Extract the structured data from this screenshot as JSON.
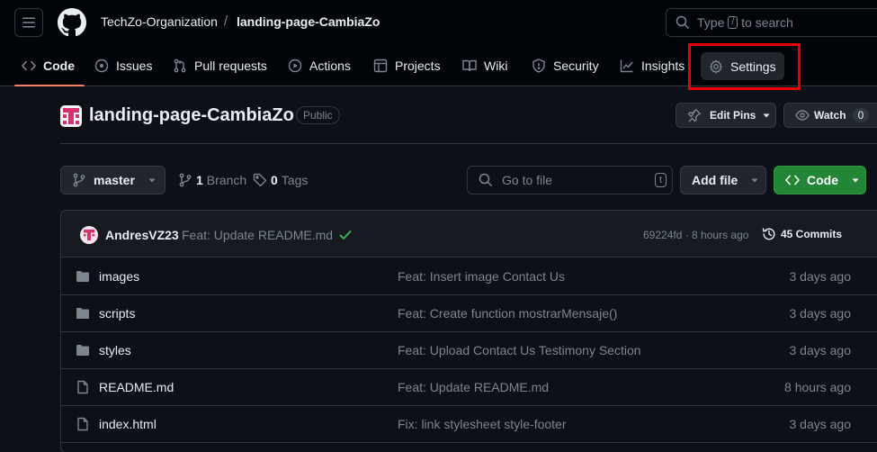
{
  "header": {
    "owner": "TechZo-Organization",
    "separator": "/",
    "repo": "landing-page-CambiaZo",
    "search_prefix": "Type",
    "search_key": "/",
    "search_suffix": "to search"
  },
  "nav": {
    "items": [
      {
        "label": "Code",
        "icon": "code-icon",
        "active": true
      },
      {
        "label": "Issues",
        "icon": "issue-icon"
      },
      {
        "label": "Pull requests",
        "icon": "pull-request-icon"
      },
      {
        "label": "Actions",
        "icon": "play-icon"
      },
      {
        "label": "Projects",
        "icon": "table-icon"
      },
      {
        "label": "Wiki",
        "icon": "book-icon"
      },
      {
        "label": "Security",
        "icon": "shield-icon"
      },
      {
        "label": "Insights",
        "icon": "graph-icon"
      },
      {
        "label": "Settings",
        "icon": "gear-icon"
      }
    ]
  },
  "repo_header": {
    "title": "landing-page-CambiaZo",
    "visibility": "Public",
    "edit_pins": "Edit Pins",
    "watch": "Watch",
    "watch_count": "0"
  },
  "toolbar": {
    "branch": "master",
    "branch_count": "1",
    "branch_label": "Branch",
    "tag_count": "0",
    "tag_label": "Tags",
    "goto_placeholder": "Go to file",
    "goto_key": "t",
    "add_file": "Add file",
    "code": "Code"
  },
  "commit": {
    "user": "AndresVZ23",
    "message": "Feat: Update README.md",
    "sha_time": "69224fd · 8 hours ago",
    "commits": "45 Commits"
  },
  "files": [
    {
      "name": "images",
      "type": "folder",
      "message": "Feat: Insert image Contact Us",
      "date": "3 days ago"
    },
    {
      "name": "scripts",
      "type": "folder",
      "message": "Feat: Create function mostrarMensaje()",
      "date": "3 days ago"
    },
    {
      "name": "styles",
      "type": "folder",
      "message": "Feat: Upload Contact Us Testimony Section",
      "date": "3 days ago"
    },
    {
      "name": "README.md",
      "type": "file",
      "message": "Feat: Update README.md",
      "date": "8 hours ago"
    },
    {
      "name": "index.html",
      "type": "file",
      "message": "Fix: link stylesheet style-footer",
      "date": "3 days ago"
    }
  ],
  "colors": {
    "bg": "#0d1117",
    "accent_underline": "#f78166",
    "code_button": "#238636",
    "highlight_box": "#ee0000",
    "check": "#3fb950"
  }
}
